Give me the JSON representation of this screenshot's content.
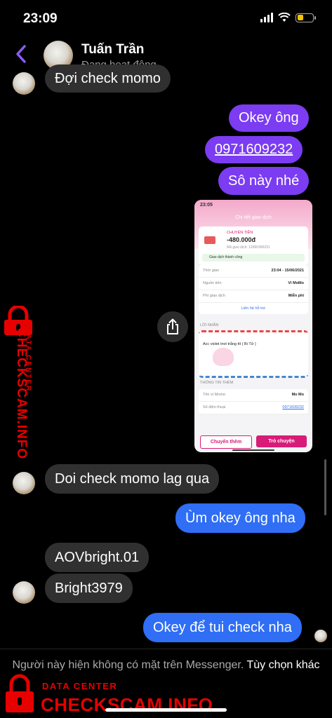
{
  "status": {
    "time": "23:09",
    "battery_color": "#f5c400"
  },
  "header": {
    "name": "Tuấn Trần",
    "status": "Đang hoạt động",
    "back_icon": "chevron-left-icon"
  },
  "messages": {
    "m1": "Đợi check momo",
    "m2": "Okey ông",
    "m3": "0971609232",
    "m4": "Sô này nhé",
    "m5": "Doi check momo lag qua",
    "m6": "Ùm okey ông nha",
    "m7": "AOVbright.01",
    "m8": "Bright3979",
    "m9": "Okey để tui check nha"
  },
  "receipt": {
    "time": "23:05",
    "title": "Chi tiết giao dịch",
    "type": "CHUYỂN TIỀN",
    "amount": "-480.000đ",
    "code": "Mã giao dịch: 12890386291",
    "status": "Giao dịch thành công",
    "rows": [
      {
        "label": "Thời gian",
        "value": "23:04 - 15/06/2021"
      },
      {
        "label": "Nguồn tiền",
        "value": "Ví MoMo"
      },
      {
        "label": "Phí giao dịch",
        "value": "Miễn phí"
      }
    ],
    "support": "Liên hệ hỗ trợ",
    "message_header": "LỜI NHẮN",
    "message": "Acc violet tnvt trắng ttt ( Bi Tử )",
    "info_header": "THÔNG TIN THÊM",
    "info": [
      {
        "label": "Tên ví Momo",
        "value": "Mo Mo"
      },
      {
        "label": "Số điện thoại",
        "value": "0971609232"
      }
    ],
    "btn_transfer": "Chuyển thêm",
    "btn_chat": "Trò chuyện"
  },
  "footer": {
    "notice": "Người này hiện không có mặt trên Messenger.",
    "options": "Tùy chọn khác"
  },
  "watermark": {
    "label": "DATA CENTER",
    "brand": "CHECKSCAM.INFO",
    "color": "#e60000"
  },
  "colors": {
    "purple": "#7b3cf2",
    "blue": "#2f6ef5",
    "incoming": "#303030"
  }
}
